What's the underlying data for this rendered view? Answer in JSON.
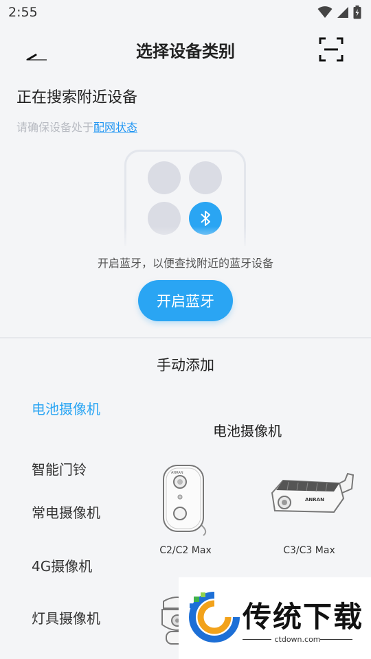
{
  "status_bar": {
    "time": "2:55"
  },
  "header": {
    "title": "选择设备类别"
  },
  "search": {
    "title": "正在搜索附近设备",
    "hint_prefix": "请确保设备处于",
    "hint_link": "配网状态"
  },
  "bluetooth": {
    "hint": "开启蓝牙，以便查找附近的蓝牙设备",
    "button_label": "开启蓝牙"
  },
  "manual": {
    "title": "手动添加",
    "categories": [
      {
        "label": "电池摄像机",
        "active": true
      },
      {
        "label": "智能门铃",
        "active": false
      },
      {
        "label": "常电摄像机",
        "active": false
      },
      {
        "label": "4G摄像机",
        "active": false
      },
      {
        "label": "灯具摄像机",
        "active": false
      }
    ],
    "section_title": "电池摄像机",
    "products": [
      {
        "name": "C2/C2 Max"
      },
      {
        "name": "C3/C3 Max"
      }
    ]
  },
  "watermark": {
    "title": "传统下载",
    "url": "ctdown.com"
  },
  "colors": {
    "accent": "#2aa5f3",
    "background": "#f4f5f7"
  }
}
